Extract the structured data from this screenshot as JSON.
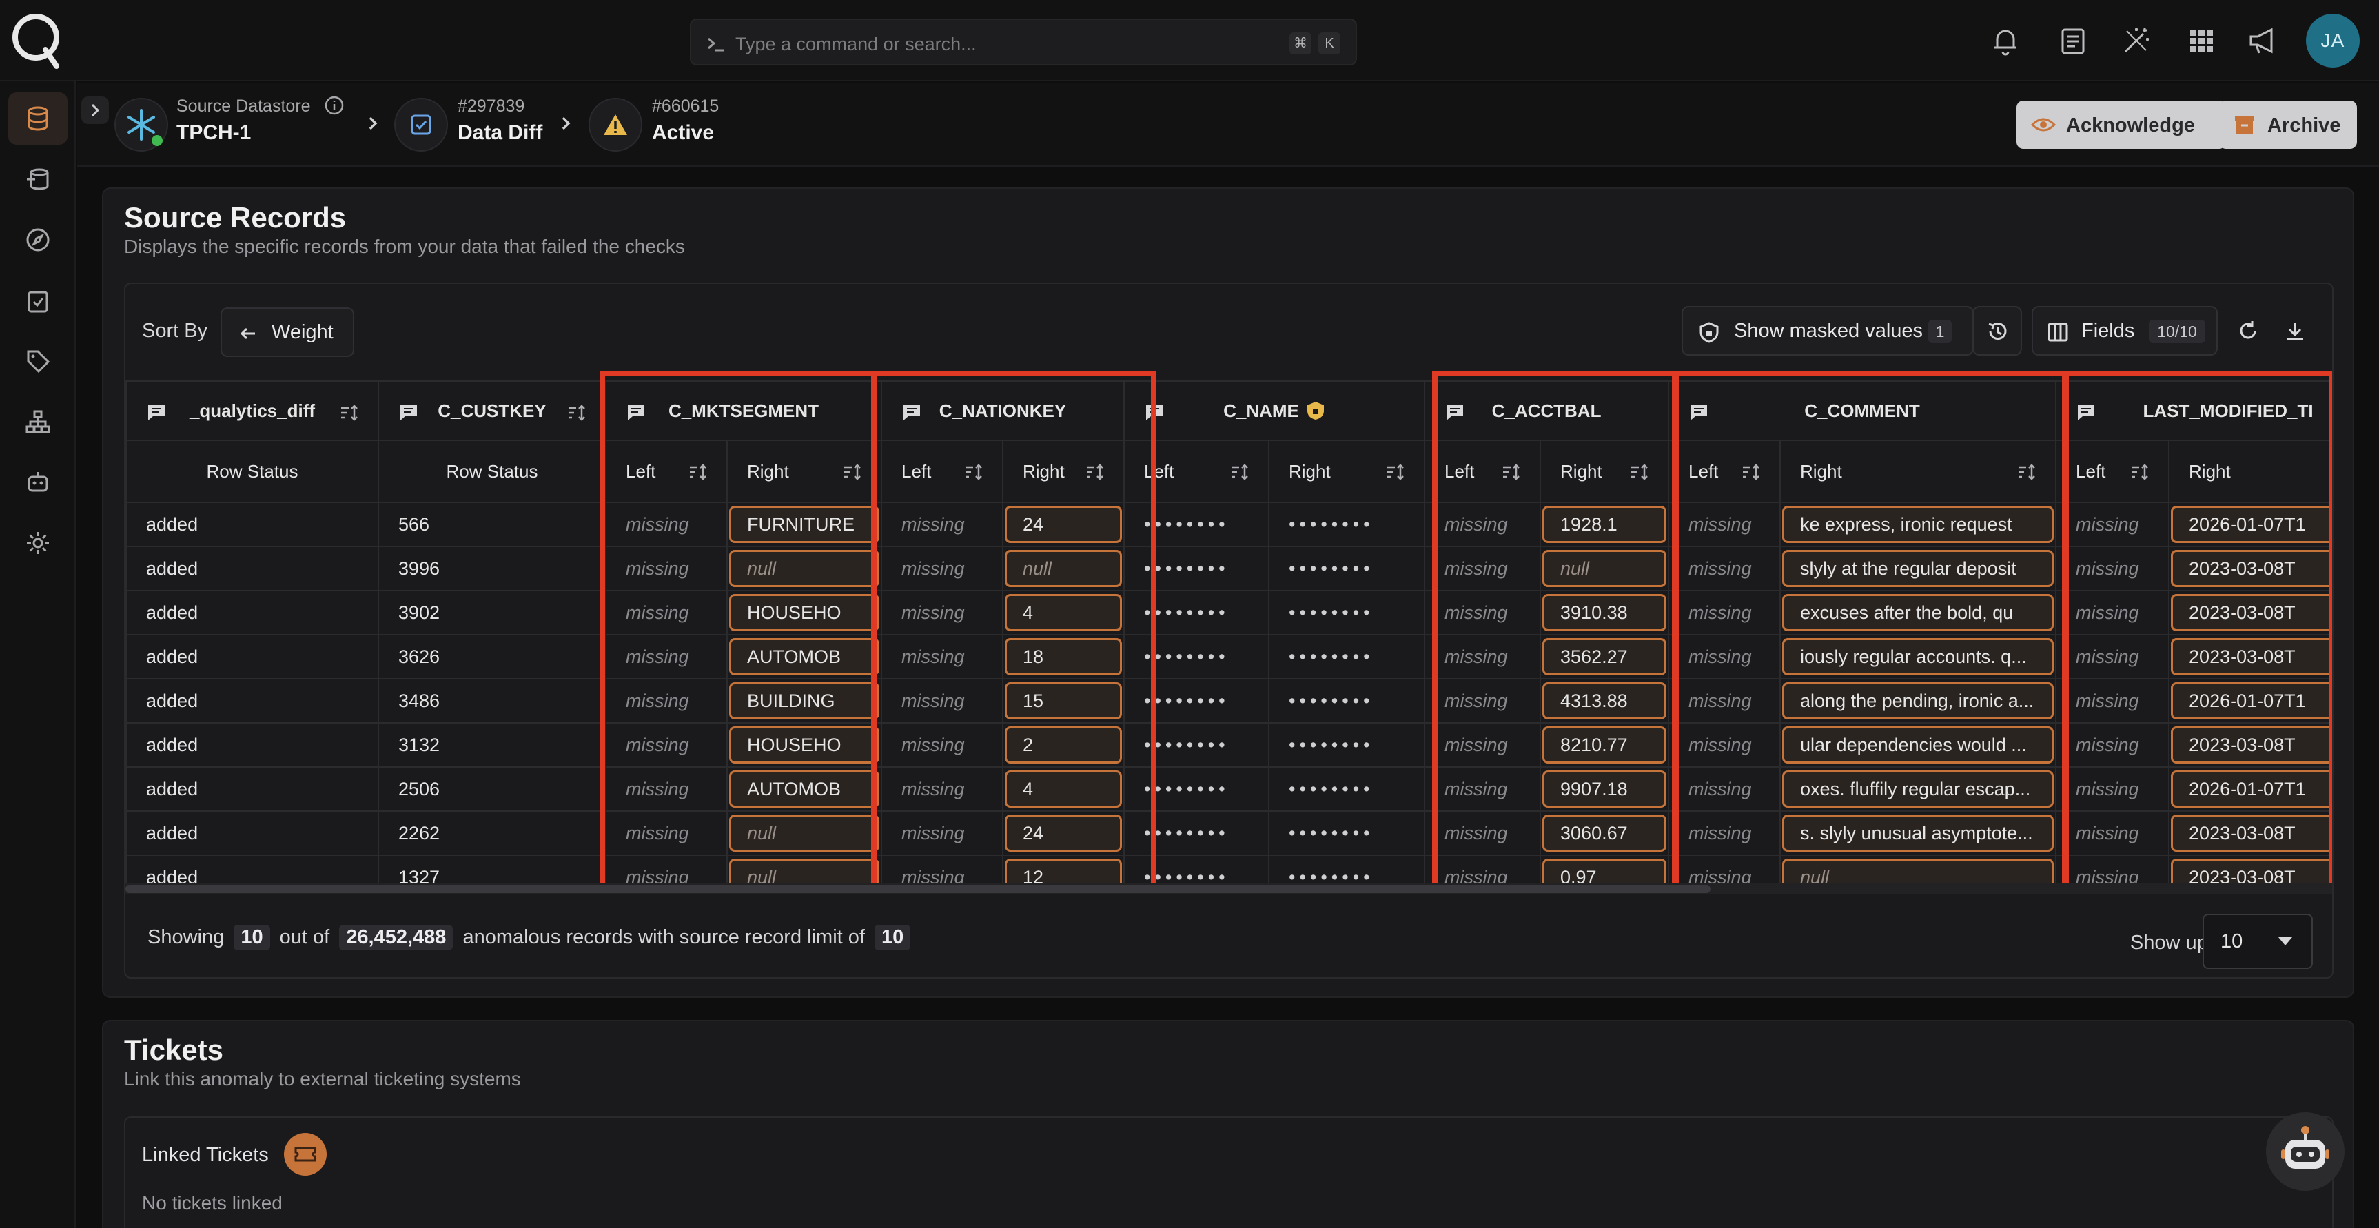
{
  "search": {
    "placeholder": "Type a command or search...",
    "kbd1": "⌘",
    "kbd2": "K"
  },
  "user": {
    "initials": "JA"
  },
  "breadcrumb": {
    "datastore_label": "Source Datastore",
    "datastore_name": "TPCH-1",
    "check_id": "#297839",
    "check_name": "Data Diff",
    "anomaly_id": "#660615",
    "anomaly_status": "Active"
  },
  "actions": {
    "acknowledge": "Acknowledge",
    "archive": "Archive"
  },
  "source_records": {
    "title": "Source Records",
    "subtitle": "Displays the specific records from your data that failed the checks",
    "sort_by": "Sort By",
    "sort_value": "Weight",
    "show_masked": "Show masked values",
    "masked_count": "1",
    "fields_label": "Fields",
    "fields_count": "10/10",
    "columns": [
      "_qualytics_diff",
      "C_CUSTKEY",
      "C_MKTSEGMENT",
      "C_NATIONKEY",
      "C_NAME",
      "C_ACCTBAL",
      "C_COMMENT",
      "LAST_MODIFIED_TI"
    ],
    "sub": {
      "row_status": "Row Status",
      "left": "Left",
      "right": "Right"
    },
    "rows": [
      [
        "added",
        "566",
        "missing",
        "FURNITURE",
        "missing",
        "24",
        "••••••••",
        "••••••••",
        "missing",
        "1928.1",
        "missing",
        "ke express, ironic requests...",
        "missing",
        "2026-01-07T1"
      ],
      [
        "added",
        "3996",
        "missing",
        "null",
        "missing",
        "null",
        "••••••••",
        "••••••••",
        "missing",
        "null",
        "missing",
        "slyly at the regular deposits...",
        "missing",
        "2023-03-08T"
      ],
      [
        "added",
        "3902",
        "missing",
        "HOUSEHOLD",
        "missing",
        "4",
        "••••••••",
        "••••••••",
        "missing",
        "3910.38",
        "missing",
        "excuses after the bold, quick...",
        "missing",
        "2023-03-08T"
      ],
      [
        "added",
        "3626",
        "missing",
        "AUTOMOBILE",
        "missing",
        "18",
        "••••••••",
        "••••••••",
        "missing",
        "3562.27",
        "missing",
        "iously regular accounts. q...",
        "missing",
        "2023-03-08T"
      ],
      [
        "added",
        "3486",
        "missing",
        "BUILDING",
        "missing",
        "15",
        "••••••••",
        "••••••••",
        "missing",
        "4313.88",
        "missing",
        "along the pending, ironic a...",
        "missing",
        "2026-01-07T1"
      ],
      [
        "added",
        "3132",
        "missing",
        "HOUSEHOLD",
        "missing",
        "2",
        "••••••••",
        "••••••••",
        "missing",
        "8210.77",
        "missing",
        "ular dependencies would ...",
        "missing",
        "2023-03-08T"
      ],
      [
        "added",
        "2506",
        "missing",
        "AUTOMOBILE",
        "missing",
        "4",
        "••••••••",
        "••••••••",
        "missing",
        "9907.18",
        "missing",
        "oxes. fluffily regular escap...",
        "missing",
        "2026-01-07T1"
      ],
      [
        "added",
        "2262",
        "missing",
        "null",
        "missing",
        "24",
        "••••••••",
        "••••••••",
        "missing",
        "3060.67",
        "missing",
        "s. slyly unusual asymptote...",
        "missing",
        "2023-03-08T"
      ],
      [
        "added",
        "1327",
        "missing",
        "null",
        "missing",
        "12",
        "••••••••",
        "••••••••",
        "missing",
        "0.97",
        "missing",
        "null",
        "missing",
        "2023-03-08T"
      ]
    ],
    "footer": {
      "showing": "Showing",
      "shown": "10",
      "out_of": "out of",
      "total": "26,452,488",
      "suffix": "anomalous records with source record limit of",
      "limit": "10",
      "show_up_to": "Show up to",
      "show_up_to_value": "10"
    }
  },
  "tickets": {
    "title": "Tickets",
    "subtitle": "Link this anomaly to external ticketing systems",
    "linked_label": "Linked Tickets",
    "empty": "No tickets linked"
  },
  "colors": {
    "accent": "#c7743a",
    "highlight_border": "#e03a24",
    "warning": "#e8b84a"
  }
}
